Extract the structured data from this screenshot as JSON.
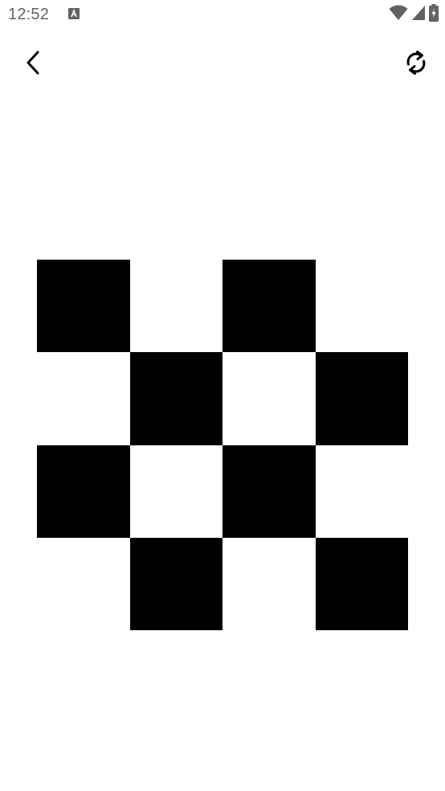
{
  "status_bar": {
    "time": "12:52",
    "notification_icon": "a-box-icon",
    "wifi_icon": "wifi-icon",
    "signal_icon": "cell-signal-icon",
    "battery_icon": "battery-charging-icon"
  },
  "toolbar": {
    "back_icon": "chevron-left-icon",
    "refresh_icon": "refresh-icon"
  },
  "board": {
    "rows": 4,
    "cols": 4,
    "cells": [
      [
        "black",
        "white",
        "black",
        "white"
      ],
      [
        "white",
        "black",
        "white",
        "black"
      ],
      [
        "black",
        "white",
        "black",
        "white"
      ],
      [
        "white",
        "black",
        "white",
        "black"
      ]
    ]
  },
  "colors": {
    "dark": "#000000",
    "light": "#ffffff",
    "status_text": "#5f6368"
  }
}
